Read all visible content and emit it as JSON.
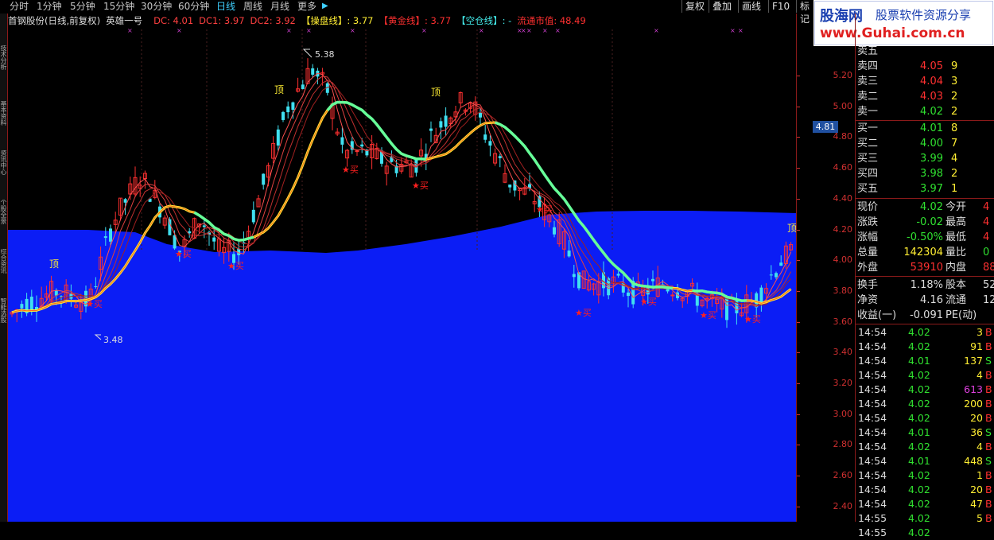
{
  "toolbar": {
    "periods": [
      "分时",
      "1分钟",
      "5分钟",
      "15分钟",
      "30分钟",
      "60分钟",
      "日线",
      "周线",
      "月线",
      "更多"
    ],
    "active": "日线",
    "more_arrow": "▶",
    "right_buttons": [
      "复权",
      "叠加",
      "画线",
      "F10",
      "标记"
    ]
  },
  "side_tabs": [
    "技术分析",
    "基本资料",
    "资讯中心",
    "个股全景",
    "综合资讯",
    "智能选股"
  ],
  "info": {
    "stock": "首钢股份(日线,前复权)",
    "indicator": "英雄一号",
    "dc": "DC: 4.01",
    "dc1": "DC1: 3.97",
    "dc2": "DC2: 3.92",
    "caopan": "【操盘线】: 3.77",
    "huangjin": "【黄金线】: 3.77",
    "kongcang": "【空仓线】: -",
    "liutong": "流通市值: 48.49"
  },
  "chart": {
    "annotations": {
      "high": "5.38",
      "low": "3.48",
      "top": "顶",
      "buy": "★买"
    },
    "price_labels": [
      "5.20",
      "5.00",
      "4.80",
      "4.60",
      "4.40",
      "4.20",
      "4.00",
      "3.80",
      "3.60",
      "3.40",
      "3.20",
      "3.00",
      "2.80",
      "2.60",
      "2.40"
    ],
    "current_price": "4.81",
    "colors": {
      "up": "#ff3030",
      "down": "#40e0f0",
      "fill": "#0b1df5",
      "ma_main": "#ffee33",
      "ma_green": "#66ff99"
    }
  },
  "logo": {
    "name": "股海网",
    "tagline": "股票软件资源分享",
    "url": "www.Guhai.com.cn"
  },
  "order_book": [
    {
      "label": "卖五",
      "price": "",
      "vol": ""
    },
    {
      "label": "卖四",
      "price": "4.05",
      "vol": "9"
    },
    {
      "label": "卖三",
      "price": "4.04",
      "vol": "3"
    },
    {
      "label": "卖二",
      "price": "4.03",
      "vol": "2"
    },
    {
      "label": "卖一",
      "price": "4.02",
      "vol": "2"
    },
    {
      "label": "买一",
      "price": "4.01",
      "vol": "8"
    },
    {
      "label": "买二",
      "price": "4.00",
      "vol": "7"
    },
    {
      "label": "买三",
      "price": "3.99",
      "vol": "4"
    },
    {
      "label": "买四",
      "price": "3.98",
      "vol": "2"
    },
    {
      "label": "买五",
      "price": "3.97",
      "vol": "1"
    }
  ],
  "quote": [
    {
      "l1": "现价",
      "v1": "4.02",
      "l2": "今开",
      "v2": "4"
    },
    {
      "l1": "涨跌",
      "v1": "-0.02",
      "l2": "最高",
      "v2": "4"
    },
    {
      "l1": "涨幅",
      "v1": "-0.50%",
      "l2": "最低",
      "v2": "4"
    },
    {
      "l1": "总量",
      "v1": "142304",
      "l2": "量比",
      "v2": "0"
    },
    {
      "l1": "外盘",
      "v1": "53910",
      "l2": "内盘",
      "v2": "88"
    }
  ],
  "fundamentals": [
    {
      "l1": "换手",
      "v1": "1.18%",
      "l2": "股本",
      "v2": "52."
    },
    {
      "l1": "净资",
      "v1": "4.16",
      "l2": "流通",
      "v2": "12."
    },
    {
      "l1": "收益(一)",
      "v1": "-0.091",
      "l2": "PE(动)",
      "v2": ""
    }
  ],
  "ticks": [
    {
      "t": "14:54",
      "p": "4.02",
      "v": "3",
      "f": "B"
    },
    {
      "t": "14:54",
      "p": "4.02",
      "v": "91",
      "f": "B"
    },
    {
      "t": "14:54",
      "p": "4.01",
      "v": "137",
      "f": "S"
    },
    {
      "t": "14:54",
      "p": "4.02",
      "v": "4",
      "f": "B"
    },
    {
      "t": "14:54",
      "p": "4.02",
      "v": "613",
      "f": "B"
    },
    {
      "t": "14:54",
      "p": "4.02",
      "v": "200",
      "f": "B"
    },
    {
      "t": "14:54",
      "p": "4.02",
      "v": "20",
      "f": "B"
    },
    {
      "t": "14:54",
      "p": "4.01",
      "v": "36",
      "f": "S"
    },
    {
      "t": "14:54",
      "p": "4.02",
      "v": "4",
      "f": "B"
    },
    {
      "t": "14:54",
      "p": "4.01",
      "v": "448",
      "f": "S"
    },
    {
      "t": "14:54",
      "p": "4.02",
      "v": "1",
      "f": "B"
    },
    {
      "t": "14:54",
      "p": "4.02",
      "v": "20",
      "f": "B"
    },
    {
      "t": "14:54",
      "p": "4.02",
      "v": "47",
      "f": "B"
    },
    {
      "t": "14:55",
      "p": "4.02",
      "v": "5",
      "f": "B"
    },
    {
      "t": "14:55",
      "p": "4.02",
      "v": "",
      "f": ""
    }
  ]
}
